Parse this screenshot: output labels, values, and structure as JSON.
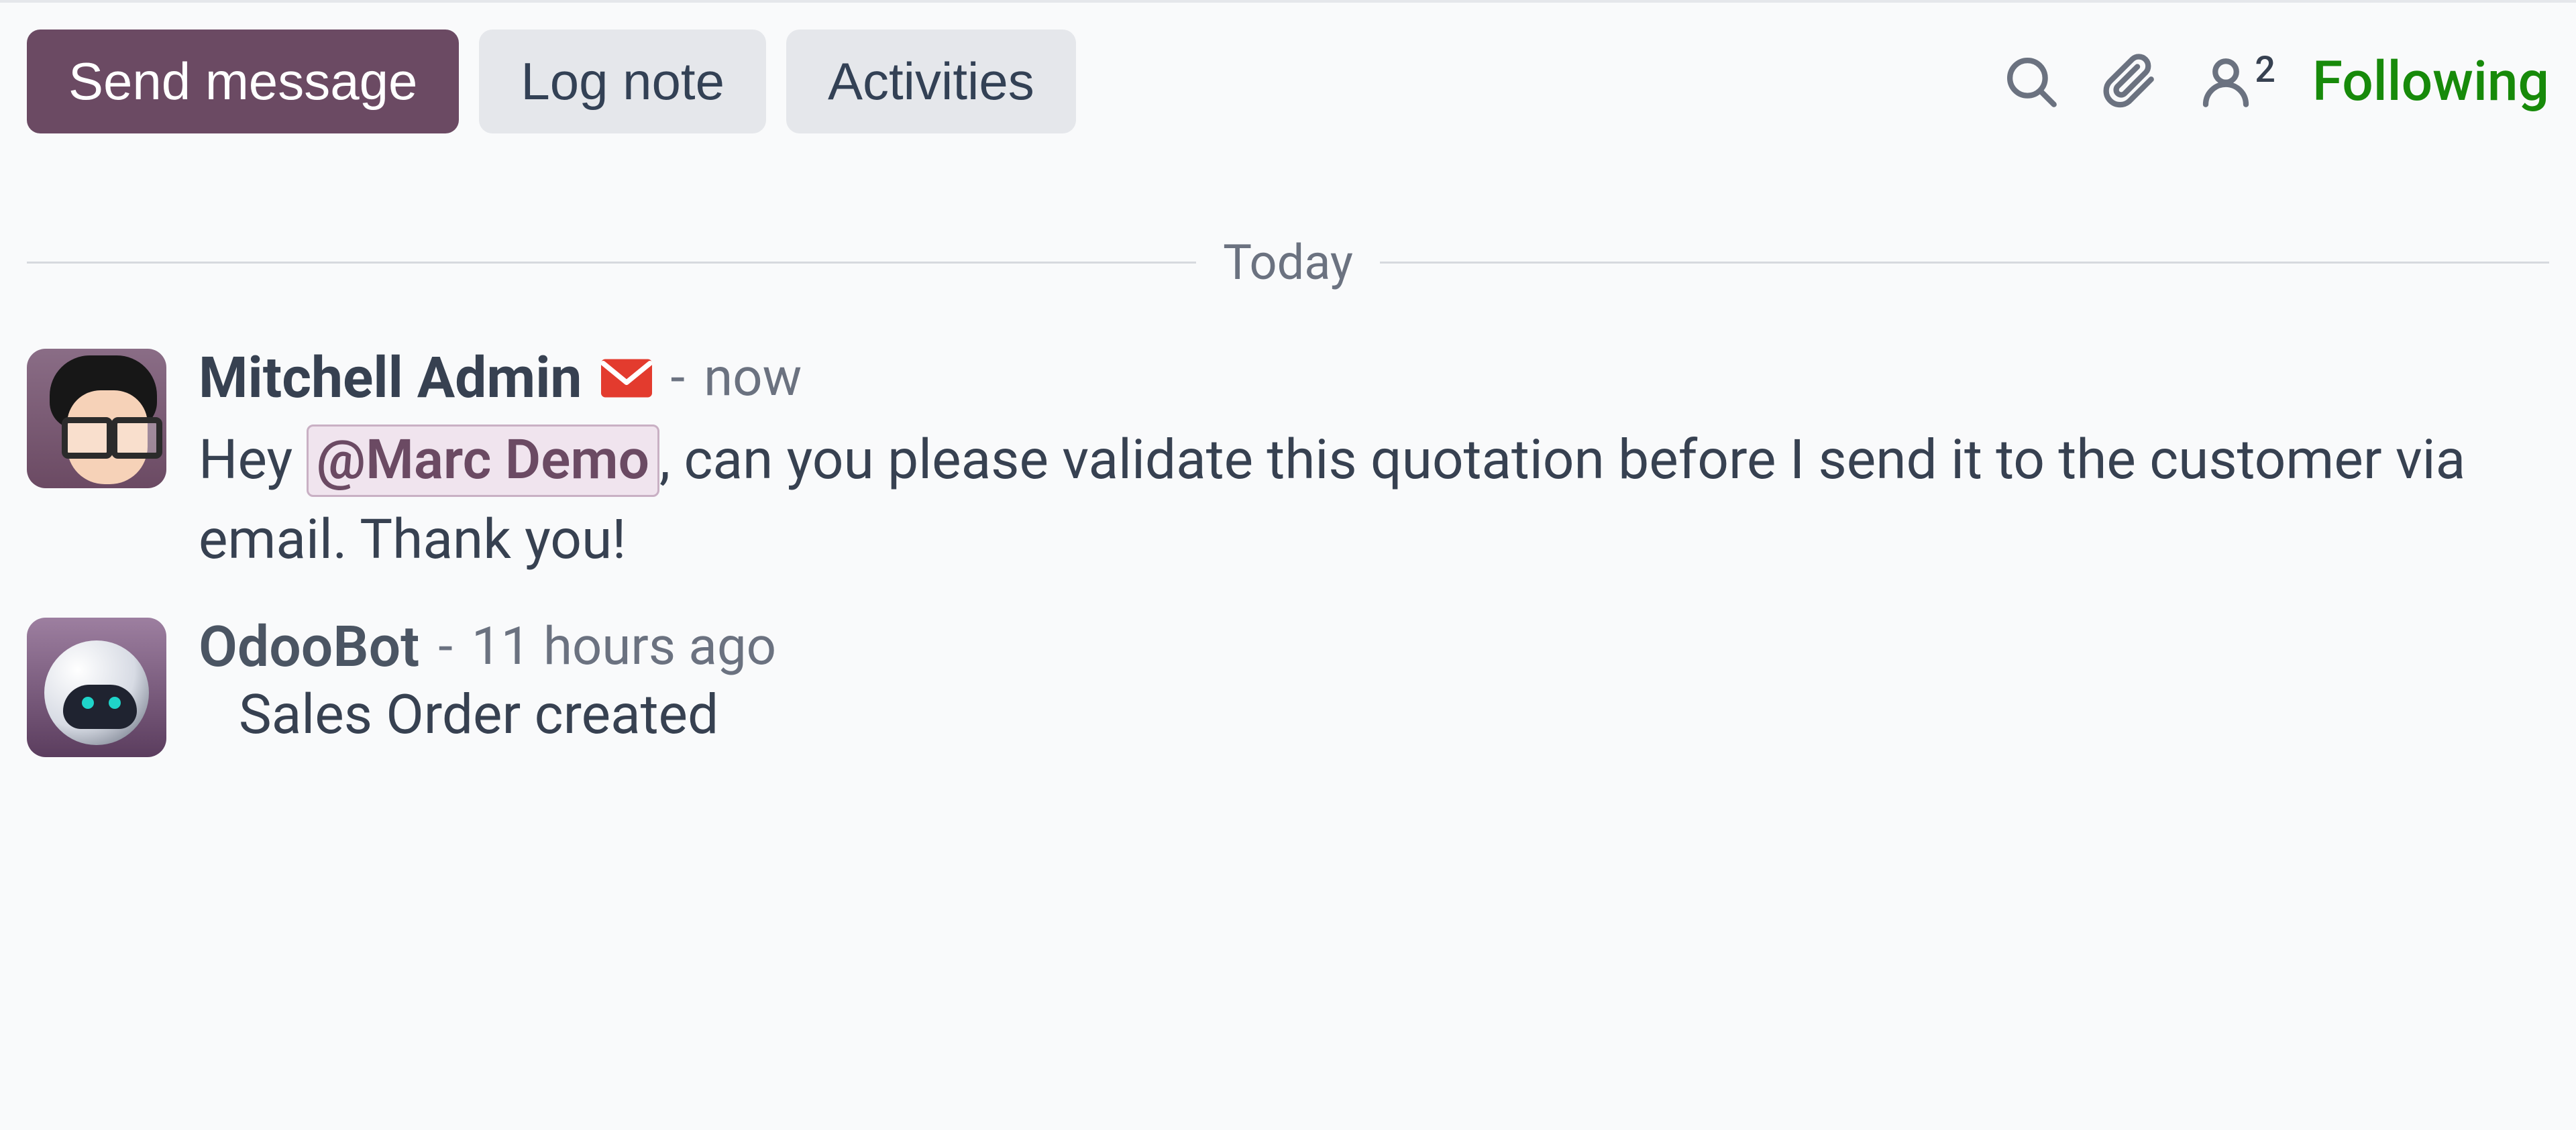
{
  "tabs": {
    "send_message": "Send message",
    "log_note": "Log note",
    "activities": "Activities"
  },
  "actions": {
    "follower_count": "2",
    "following_label": "Following"
  },
  "separator": {
    "today": "Today"
  },
  "messages": [
    {
      "author": "Mitchell Admin",
      "time_sep": "-",
      "time": "now",
      "has_email_icon": true,
      "body_prefix": "Hey ",
      "mention": "@Marc Demo",
      "body_suffix": ", can you please validate this quotation before I send it to the customer via email. Thank you!"
    },
    {
      "author": "OdooBot",
      "time_sep": "-",
      "time": "11 hours ago",
      "body": "Sales Order created"
    }
  ]
}
